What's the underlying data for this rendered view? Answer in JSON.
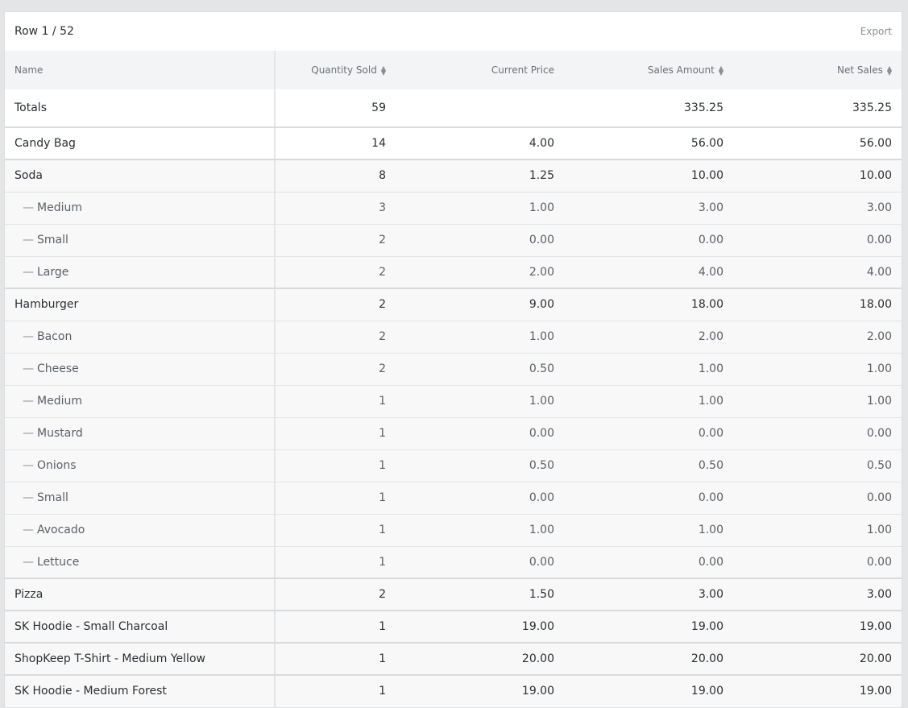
{
  "toolbar": {
    "row_counter": "Row 1 / 52",
    "export_label": "Export"
  },
  "table": {
    "columns": [
      {
        "label": "Name",
        "sortable": false
      },
      {
        "label": "Quantity Sold",
        "sortable": true
      },
      {
        "label": "Current Price",
        "sortable": false
      },
      {
        "label": "Sales Amount",
        "sortable": true
      },
      {
        "label": "Net Sales",
        "sortable": true
      }
    ],
    "totals": {
      "name": "Totals",
      "quantity": "59",
      "price": "",
      "sales": "335.25",
      "net": "335.25"
    },
    "rows": [
      {
        "name": "Candy Bag",
        "quantity": "14",
        "price": "4.00",
        "sales": "56.00",
        "net": "56.00",
        "type": "parent"
      },
      {
        "name": "Soda",
        "quantity": "8",
        "price": "1.25",
        "sales": "10.00",
        "net": "10.00",
        "type": "parent"
      },
      {
        "name": "Medium",
        "quantity": "3",
        "price": "1.00",
        "sales": "3.00",
        "net": "3.00",
        "type": "child"
      },
      {
        "name": "Small",
        "quantity": "2",
        "price": "0.00",
        "sales": "0.00",
        "net": "0.00",
        "type": "child"
      },
      {
        "name": "Large",
        "quantity": "2",
        "price": "2.00",
        "sales": "4.00",
        "net": "4.00",
        "type": "child"
      },
      {
        "name": "Hamburger",
        "quantity": "2",
        "price": "9.00",
        "sales": "18.00",
        "net": "18.00",
        "type": "parent"
      },
      {
        "name": "Bacon",
        "quantity": "2",
        "price": "1.00",
        "sales": "2.00",
        "net": "2.00",
        "type": "child"
      },
      {
        "name": "Cheese",
        "quantity": "2",
        "price": "0.50",
        "sales": "1.00",
        "net": "1.00",
        "type": "child"
      },
      {
        "name": "Medium",
        "quantity": "1",
        "price": "1.00",
        "sales": "1.00",
        "net": "1.00",
        "type": "child"
      },
      {
        "name": "Mustard",
        "quantity": "1",
        "price": "0.00",
        "sales": "0.00",
        "net": "0.00",
        "type": "child"
      },
      {
        "name": "Onions",
        "quantity": "1",
        "price": "0.50",
        "sales": "0.50",
        "net": "0.50",
        "type": "child"
      },
      {
        "name": "Small",
        "quantity": "1",
        "price": "0.00",
        "sales": "0.00",
        "net": "0.00",
        "type": "child"
      },
      {
        "name": "Avocado",
        "quantity": "1",
        "price": "1.00",
        "sales": "1.00",
        "net": "1.00",
        "type": "child"
      },
      {
        "name": "Lettuce",
        "quantity": "1",
        "price": "0.00",
        "sales": "0.00",
        "net": "0.00",
        "type": "child"
      },
      {
        "name": "Pizza",
        "quantity": "2",
        "price": "1.50",
        "sales": "3.00",
        "net": "3.00",
        "type": "parent"
      },
      {
        "name": "SK Hoodie - Small Charcoal",
        "quantity": "1",
        "price": "19.00",
        "sales": "19.00",
        "net": "19.00",
        "type": "parent"
      },
      {
        "name": "ShopKeep T-Shirt - Medium Yellow",
        "quantity": "1",
        "price": "20.00",
        "sales": "20.00",
        "net": "20.00",
        "type": "parent"
      },
      {
        "name": "SK Hoodie - Medium Forest",
        "quantity": "1",
        "price": "19.00",
        "sales": "19.00",
        "net": "19.00",
        "type": "parent"
      }
    ],
    "child_prefix": "—",
    "sort_icon": "sort-up-down-icon"
  }
}
